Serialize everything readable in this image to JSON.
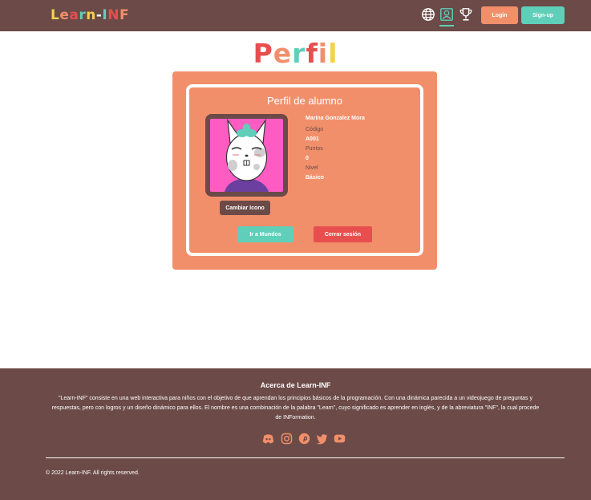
{
  "header": {
    "logo_text": "Learn-INF",
    "logo_letters": [
      {
        "ch": "L",
        "color": "#f2d24f"
      },
      {
        "ch": "e",
        "color": "#f28f6b"
      },
      {
        "ch": "a",
        "color": "#e84e4e"
      },
      {
        "ch": "r",
        "color": "#5fcfb9"
      },
      {
        "ch": "n",
        "color": "#f2d24f"
      },
      {
        "ch": "-",
        "color": "#ffffff"
      },
      {
        "ch": "I",
        "color": "#5fcfb9"
      },
      {
        "ch": "N",
        "color": "#e84e4e"
      },
      {
        "ch": "F",
        "color": "#f28f6b"
      }
    ],
    "icons": [
      "globe-icon",
      "profile-icon",
      "trophy-icon"
    ],
    "login_label": "Login",
    "signup_label": "Sign-up"
  },
  "page": {
    "title": "Perfil",
    "title_letters": [
      {
        "ch": "P",
        "color": "#e84e4e"
      },
      {
        "ch": "e",
        "color": "#f28f6b"
      },
      {
        "ch": "r",
        "color": "#5fcfb9"
      },
      {
        "ch": "f",
        "color": "#e84e4e"
      },
      {
        "ch": "i",
        "color": "#f28f6b"
      },
      {
        "ch": "l",
        "color": "#f2d24f"
      }
    ]
  },
  "profile": {
    "card_title": "Perfil de alumno",
    "name": "Marina Gonzalez Mora",
    "code_label": "Código",
    "code_value": "A001",
    "points_label": "Puntos",
    "points_value": "0",
    "level_label": "Nivel",
    "level_value": "Básico",
    "change_icon_label": "Cambiar Icono",
    "worlds_label": "Ir a Mundos",
    "logout_label": "Cerrar sesión"
  },
  "footer": {
    "title": "Acerca de Learn-INF",
    "description": "\"Learn-INF\" consiste en una web interactiva para niños con el objetivo de que aprendan los principios básicos de la programación. Con una dinámica parecida a un videojuego de preguntas y respuestas, pero con logros y un diseño dinámico para ellos. El nombre es una combinación de la palabra \"Learn\", cuyo significado es aprender en inglés, y de la abreviatura \"INF\", la cual procede de INFormation.",
    "social_icons": [
      "discord-icon",
      "instagram-icon",
      "pinterest-icon",
      "twitter-icon",
      "youtube-icon"
    ],
    "copyright": "© 2022 Learn-INF. All rights reserved."
  },
  "colors": {
    "brown": "#6b4a47",
    "salmon": "#f28f6b",
    "teal": "#5fcfb9",
    "red": "#e84e4e",
    "avatar_bg": "#ff5cc3"
  }
}
